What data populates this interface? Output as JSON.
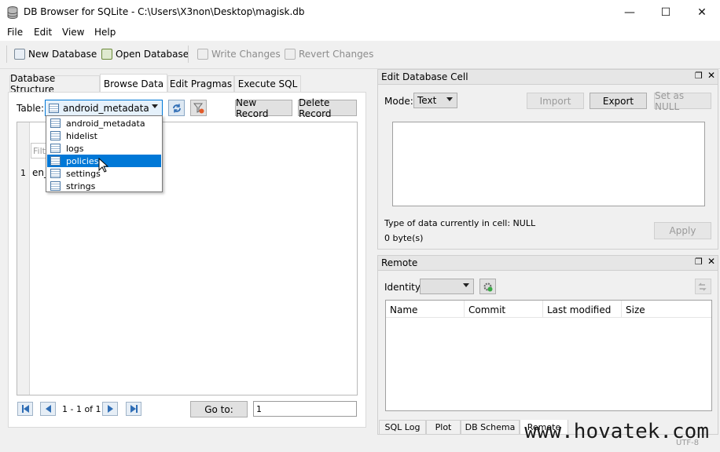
{
  "window": {
    "title": "DB Browser for SQLite - C:\\Users\\X3non\\Desktop\\magisk.db",
    "controls": {
      "minimize": "—",
      "maximize": "☐",
      "close": "✕"
    }
  },
  "menu": [
    "File",
    "Edit",
    "View",
    "Help"
  ],
  "toolbar": {
    "new_db": "New Database",
    "open_db": "Open Database",
    "write": "Write Changes",
    "revert": "Revert Changes"
  },
  "tabs": [
    "Database Structure",
    "Browse Data",
    "Edit Pragmas",
    "Execute SQL"
  ],
  "browse": {
    "table_label": "Table:",
    "selected_table": "android_metadata",
    "new_record": "New Record",
    "delete_record": "Delete Record",
    "filter_placeholder": "Filt",
    "row_number": "1",
    "row_value": "en_",
    "tables": [
      "android_metadata",
      "hidelist",
      "logs",
      "policies",
      "settings",
      "strings"
    ],
    "highlighted": "policies",
    "nav_text": "1 - 1 of 1",
    "goto": "Go to:",
    "goto_value": "1"
  },
  "edit_cell": {
    "title": "Edit Database Cell",
    "mode_label": "Mode:",
    "mode_value": "Text",
    "import": "Import",
    "export": "Export",
    "set_null": "Set as NULL",
    "type_info": "Type of data currently in cell: NULL",
    "size_info": "0 byte(s)",
    "apply": "Apply"
  },
  "remote": {
    "title": "Remote",
    "identity_label": "Identity",
    "columns": [
      "Name",
      "Commit",
      "Last modified",
      "Size"
    ]
  },
  "bottom_tabs": [
    "SQL Log",
    "Plot",
    "DB Schema",
    "Remote"
  ],
  "status": {
    "encoding": "UTF-8"
  },
  "watermark": "www.hovatek.com",
  "colors": {
    "selection": "#0078d7",
    "background": "#f0f0f0"
  }
}
